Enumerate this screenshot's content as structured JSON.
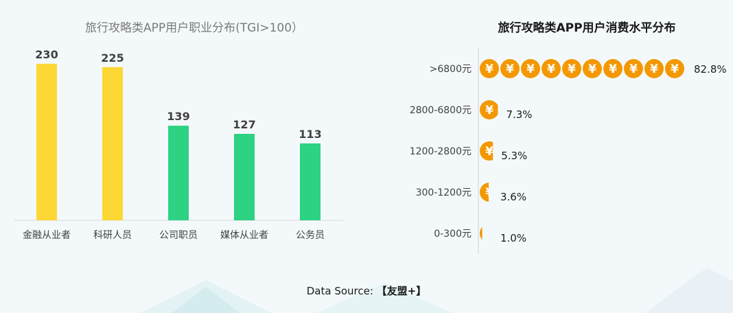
{
  "chart_data": [
    {
      "type": "bar",
      "title": "旅行攻略类APP用户职业分布(TGI>100）",
      "categories": [
        "金融从业者",
        "科研人员",
        "公司职员",
        "媒体从业者",
        "公务员"
      ],
      "values": [
        230,
        225,
        139,
        127,
        113
      ],
      "ylim": [
        0,
        250
      ],
      "grid": false,
      "colors": [
        "#fdd835",
        "#fdd835",
        "#2ed283",
        "#2ed283",
        "#2ed283"
      ]
    },
    {
      "type": "bar",
      "orientation": "horizontal",
      "title": "旅行攻略类APP用户消费水平分布",
      "categories": [
        ">6800元",
        "2800-6800元",
        "1200-2800元",
        "300-1200元",
        "0-300元"
      ],
      "values": [
        82.8,
        7.3,
        5.3,
        3.6,
        1.0
      ],
      "value_labels": [
        "82.8%",
        "7.3%",
        "5.3%",
        "3.6%",
        "1.0%"
      ],
      "xlim": [
        0,
        100
      ],
      "icon": "yuan-coin-icon",
      "icon_symbol": "¥",
      "icon_color": "#f39800"
    }
  ],
  "footer": {
    "label": "Data Source:",
    "source": "【友盟+】"
  }
}
